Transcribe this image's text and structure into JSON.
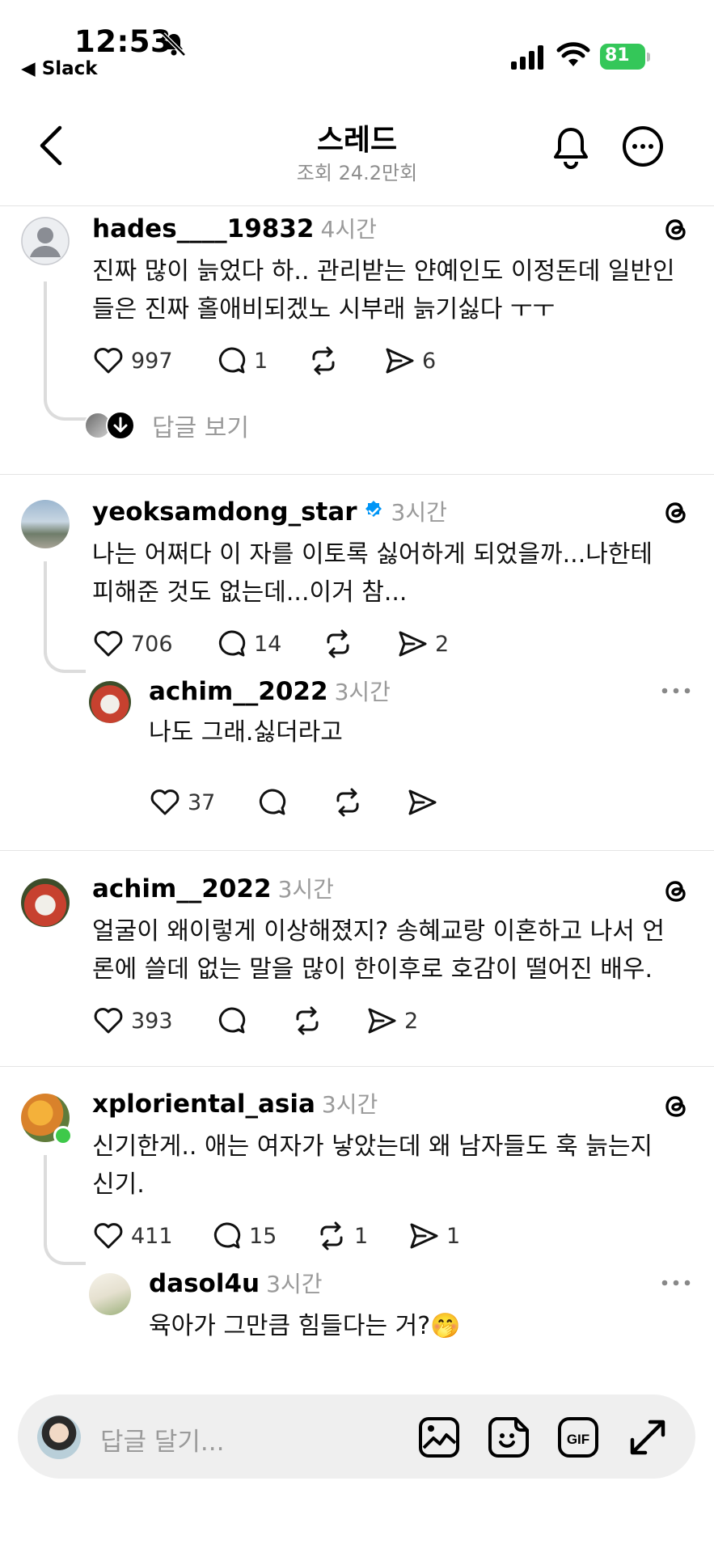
{
  "status_bar": {
    "time": "12:53",
    "back_app": "◀ Slack",
    "battery": "81"
  },
  "header": {
    "title": "스레드",
    "subtitle": "조회 24.2만회"
  },
  "posts": [
    {
      "username": "hades____19832",
      "time": "4시간",
      "lines": [
        "진짜 많이 늙었다 하.. 관리받는 얀예인도 이정돈데 일반인",
        "들은 진짜 홀애비되겠노 시부래 늙기싫다 ㅜㅜ"
      ],
      "likes": "997",
      "comments": "1",
      "reposts": "",
      "shares": "6",
      "see_replies": "답글 보기"
    },
    {
      "username": "yeoksamdong_star",
      "time": "3시간",
      "lines": [
        "나는 어쩌다 이 자를 이토록 싫어하게 되었을까...나한테",
        "피해준 것도 없는데...이거 참..."
      ],
      "likes": "706",
      "comments": "14",
      "reposts": "",
      "shares": "2",
      "reply": {
        "username": "achim__2022",
        "time": "3시간",
        "text": "나도 그래.싫더라고",
        "likes": "37"
      }
    },
    {
      "username": "achim__2022",
      "time": "3시간",
      "lines": [
        "얼굴이 왜이렇게 이상해졌지? 송혜교랑 이혼하고 나서 언",
        "론에 쓸데 없는 말을 많이 한이후로 호감이 떨어진 배우."
      ],
      "likes": "393",
      "comments": "",
      "reposts": "",
      "shares": "2"
    },
    {
      "username": "xploriental_asia",
      "time": "3시간",
      "lines": [
        "신기한게.. 애는 여자가 낳았는데 왜 남자들도 훅 늙는지",
        "신기."
      ],
      "likes": "411",
      "comments": "15",
      "reposts": "1",
      "shares": "1",
      "reply": {
        "username": "dasol4u",
        "time": "3시간",
        "text": "육아가 그만큼 힘들다는 거?🤭"
      }
    }
  ],
  "composer": {
    "placeholder": "답글 달기..."
  },
  "icons": {
    "like": "heart-icon",
    "comment": "comment-bubble-icon",
    "repost": "repost-icon",
    "share": "send-icon",
    "threads": "threads-logo-icon"
  },
  "colors": {
    "battery": "#34c759",
    "verified": "#0095f6",
    "online": "#3ec94a",
    "muted": "#9a9a9a"
  }
}
